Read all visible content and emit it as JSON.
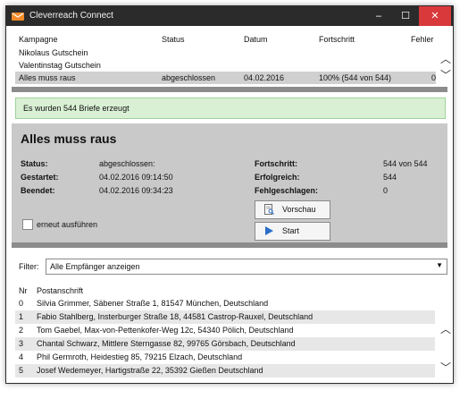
{
  "window": {
    "title": "Cleverreach Connect",
    "controls": {
      "minimize": "–",
      "maximize": "☐",
      "close": "✕"
    }
  },
  "campaigns": {
    "columns": [
      "Kampagne",
      "Status",
      "Datum",
      "Fortschritt",
      "Fehler"
    ],
    "rows": [
      {
        "name": "Nikolaus Gutschein",
        "status": "",
        "date": "",
        "progress": "",
        "errors": ""
      },
      {
        "name": "Valentinstag Gutschein",
        "status": "",
        "date": "",
        "progress": "",
        "errors": ""
      },
      {
        "name": "Alles muss raus",
        "status": "abgeschlossen",
        "date": "04.02.2016",
        "progress": "100% (544 von 544)",
        "errors": "0",
        "selected": true
      }
    ]
  },
  "message": "Es wurden 544 Briefe erzeugt",
  "details": {
    "title": "Alles muss raus",
    "status_label": "Status:",
    "status_value": "abgeschlossen:",
    "started_label": "Gestartet:",
    "started_value": "04.02.2016 09:14:50",
    "ended_label": "Beendet:",
    "ended_value": "04.02.2016 09:34:23",
    "progress_label": "Fortschritt:",
    "progress_value": "544 von 544",
    "success_label": "Erfolgreich:",
    "success_value": "544",
    "failed_label": "Fehlgeschlagen:",
    "failed_value": "0",
    "rerun_label": "erneut ausführen",
    "rerun_checked": false,
    "preview_button": "Vorschau",
    "start_button": "Start"
  },
  "filter": {
    "label": "Filter:",
    "selected": "Alle Empfänger anzeigen"
  },
  "recipients": {
    "columns": [
      "Nr",
      "Postanschrift"
    ],
    "rows": [
      {
        "nr": "0",
        "address": "Silvia Grimmer, Säbener Straße 1, 81547 München, Deutschland"
      },
      {
        "nr": "1",
        "address": "Fabio Stahlberg, Insterburger Straße 18, 44581 Castrop-Rauxel, Deutschland"
      },
      {
        "nr": "2",
        "address": "Tom Gaebel, Max-von-Pettenkofer-Weg 12c, 54340 Pölich, Deutschland"
      },
      {
        "nr": "3",
        "address": "Chantal Schwarz, Mittlere Sterngasse 82, 99765 Görsbach, Deutschland"
      },
      {
        "nr": "4",
        "address": "Phil Germroth, Heidestieg 85, 79215 Elzach, Deutschland"
      },
      {
        "nr": "5",
        "address": "Josef Wedemeyer, Hartigstraße 22, 35392 Gießen Deutschland"
      }
    ]
  },
  "colors": {
    "titlebar": "#2b2b2b",
    "close": "#d9393b",
    "success_bg": "#d9f0d4",
    "panel_bg": "#c9c9c9"
  }
}
